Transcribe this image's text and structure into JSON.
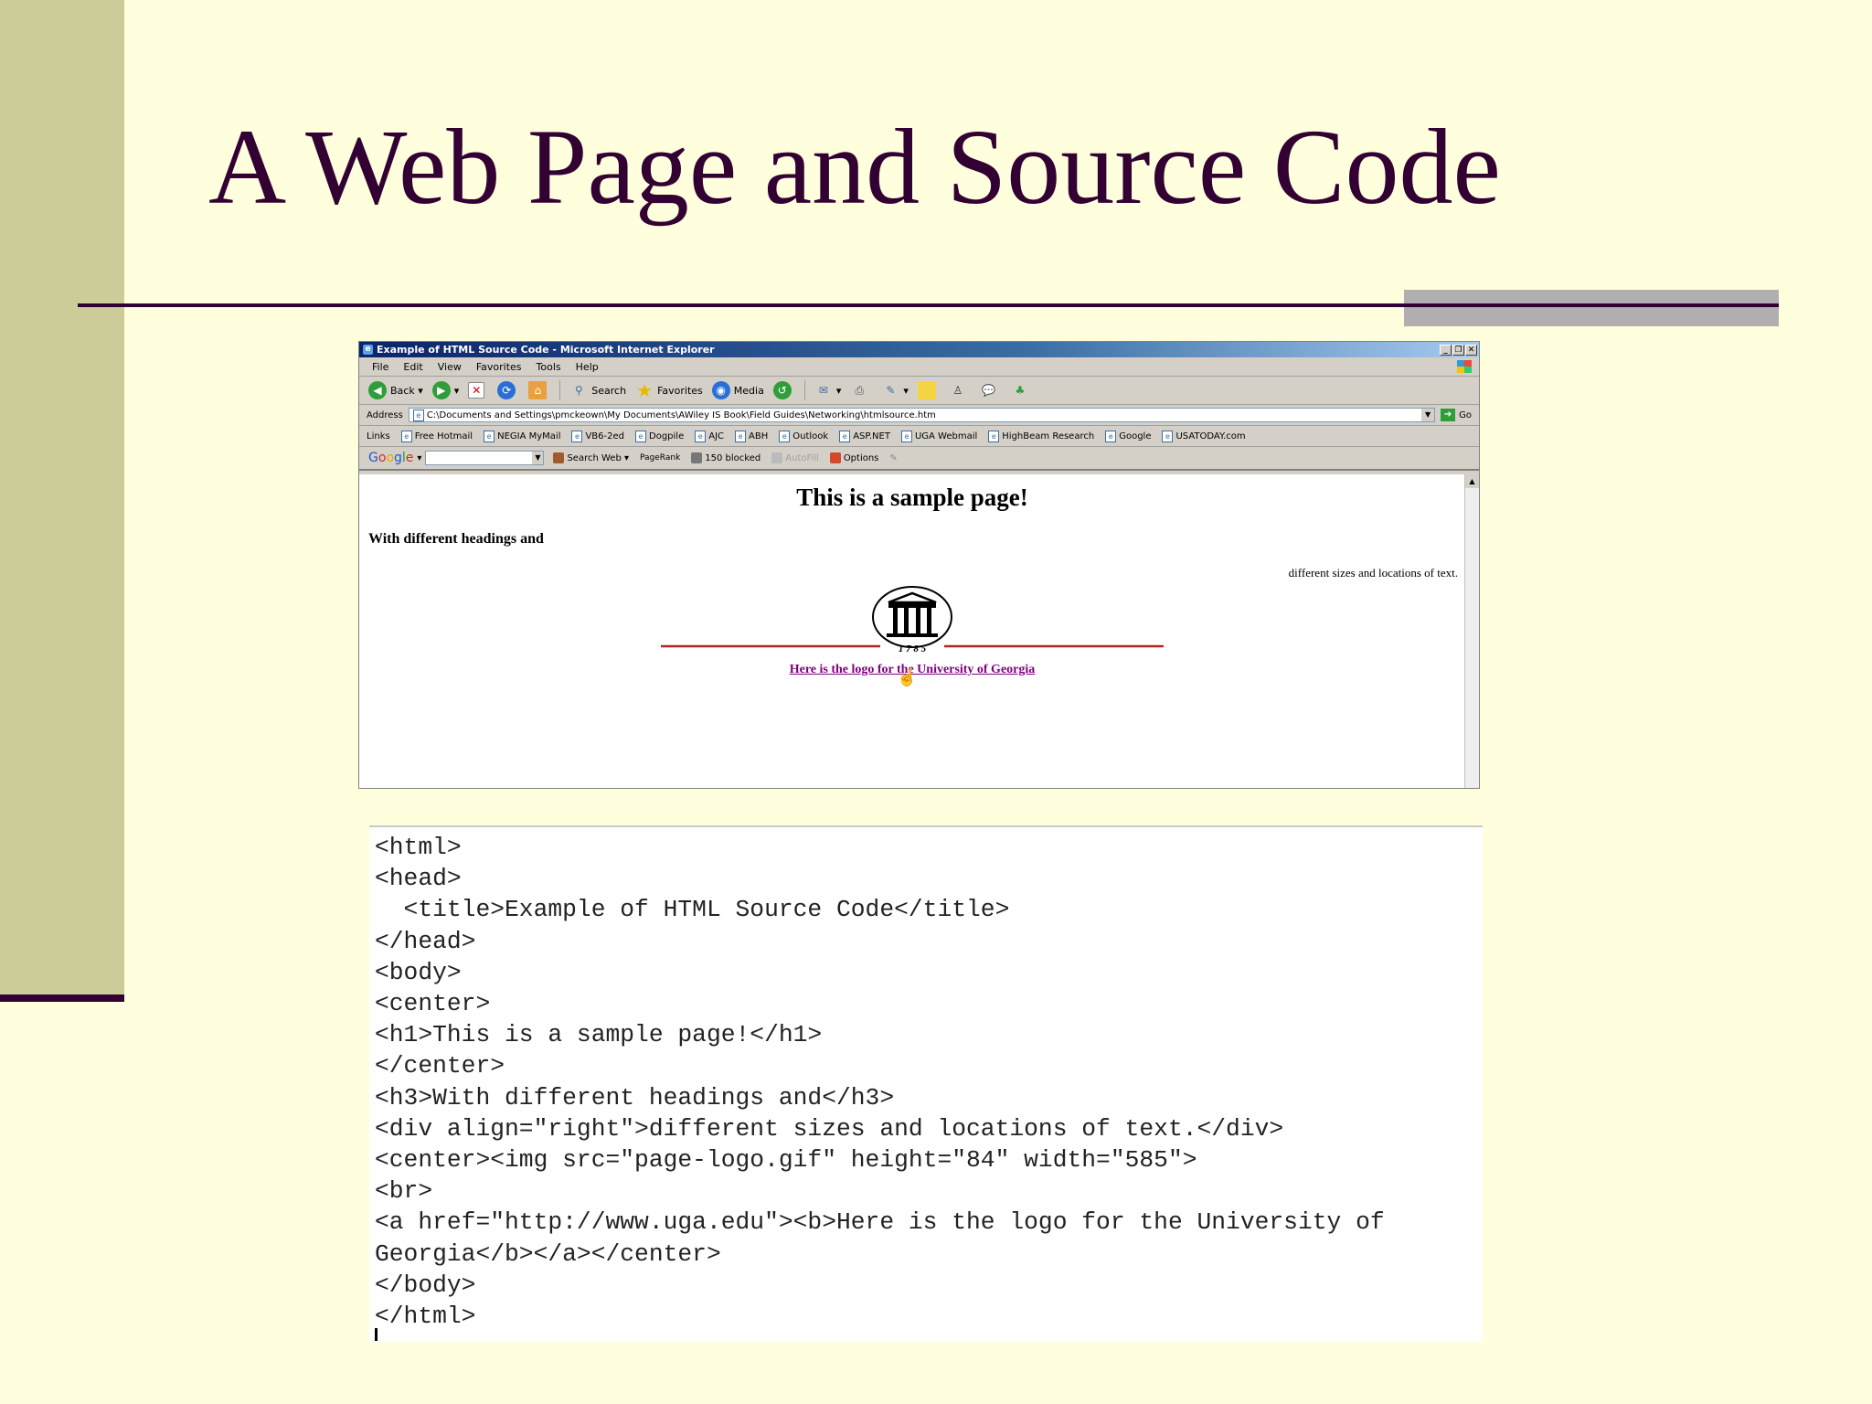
{
  "slide": {
    "title": "A Web Page and Source Code"
  },
  "browser": {
    "window_title": "Example of HTML Source Code - Microsoft Internet Explorer",
    "menu": [
      "File",
      "Edit",
      "View",
      "Favorites",
      "Tools",
      "Help"
    ],
    "toolbar": {
      "back": "Back",
      "search": "Search",
      "favorites": "Favorites",
      "media": "Media"
    },
    "address": {
      "label": "Address",
      "value": "C:\\Documents and Settings\\pmckeown\\My Documents\\AWiley IS Book\\Field Guides\\Networking\\htmlsource.htm",
      "go": "Go"
    },
    "links": {
      "label": "Links",
      "items": [
        "Free Hotmail",
        "NEGIA MyMail",
        "VB6-2ed",
        "Dogpile",
        "AJC",
        "ABH",
        "Outlook",
        "ASP.NET",
        "UGA Webmail",
        "HighBeam Research",
        "Google",
        "USATODAY.com"
      ]
    },
    "google_bar": {
      "logo": "Google",
      "search_web": "Search Web",
      "pagerank": "PageRank",
      "blocked": "150 blocked",
      "autofill": "AutoFill",
      "options": "Options"
    },
    "page": {
      "h1": "This is a sample page!",
      "h3": "With different headings and",
      "right_text": "different sizes and locations of text.",
      "logo_year": "1 7 8 5",
      "link_text": "Here is the logo for the University of Georgia"
    }
  },
  "source_code": {
    "lines": "<html>\n<head>\n  <title>Example of HTML Source Code</title>\n</head>\n<body>\n<center>\n<h1>This is a sample page!</h1>\n</center>\n<h3>With different headings and</h3>\n<div align=\"right\">different sizes and locations of text.</div>\n<center><img src=\"page-logo.gif\" height=\"84\" width=\"585\">\n<br>\n<a href=\"http://www.uga.edu\"><b>Here is the logo for the University of\nGeorgia</b></a></center>\n</body>\n</html>"
  },
  "colors": {
    "slide_background": "#ffffdd",
    "side_bar": "#cccc99",
    "accent": "#330033",
    "link_visited": "#800080",
    "logo_rule": "#b22222"
  }
}
